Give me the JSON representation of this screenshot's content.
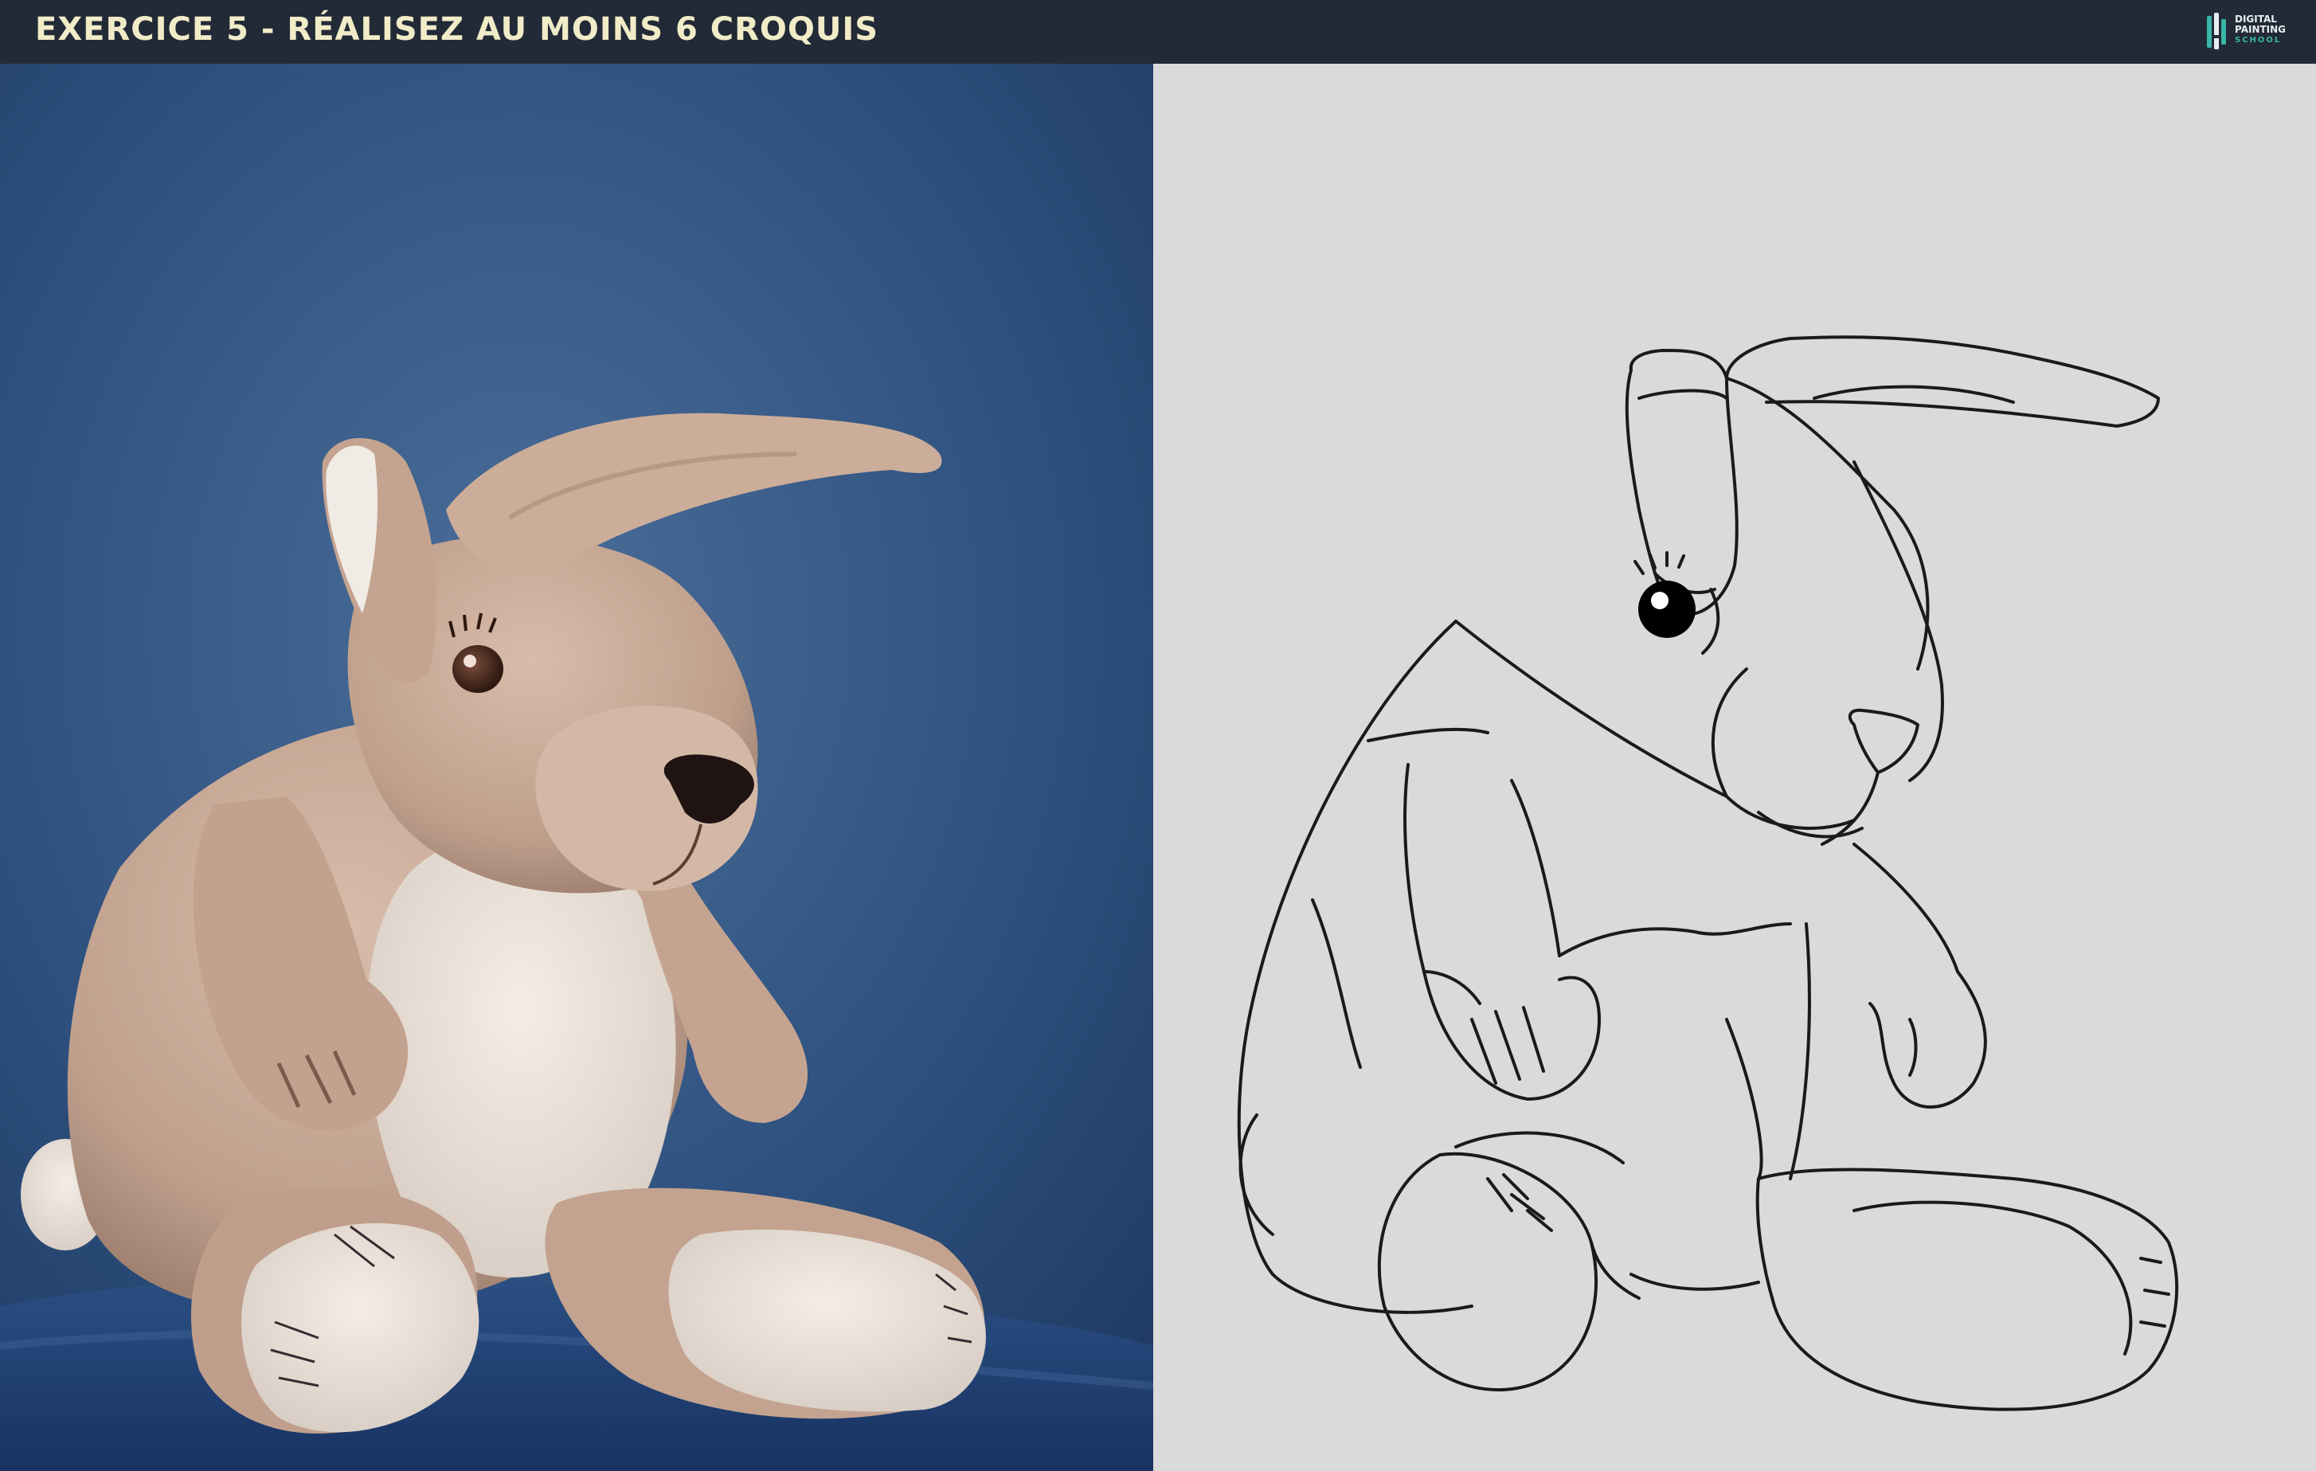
{
  "header": {
    "title": "EXERCICE 5 - RÉALISEZ AU MOINS 6 CROQUIS",
    "logo": {
      "line1": "DIGITAL",
      "line2": "PAINTING",
      "line3": "SCHOOL",
      "icon": "brush-logo-icon"
    }
  },
  "colors": {
    "header_bg": "#222a37",
    "title": "#f1ecc8",
    "accent": "#39b6a8",
    "backdrop_blue": "#2f5280",
    "plush_beige": "#c6a896",
    "plush_cream": "#ece3dc",
    "sketch_bg": "#dadada",
    "sketch_line": "#1a1a1a"
  }
}
